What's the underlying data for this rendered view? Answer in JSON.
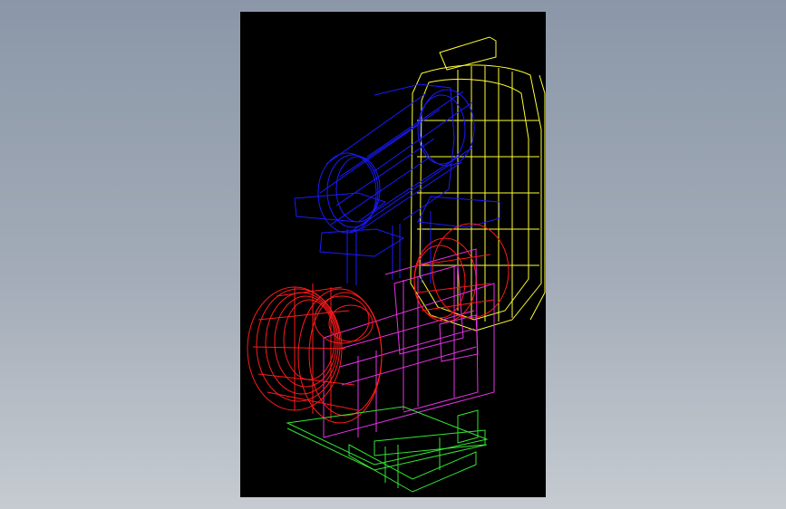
{
  "viewport": {
    "background": "#000000",
    "layer_colors": {
      "motor": "#1a1aff",
      "housing": "#ff1a1a",
      "belt_guard": "#ffff33",
      "frame": "#e632e6",
      "base": "#33e633"
    }
  }
}
